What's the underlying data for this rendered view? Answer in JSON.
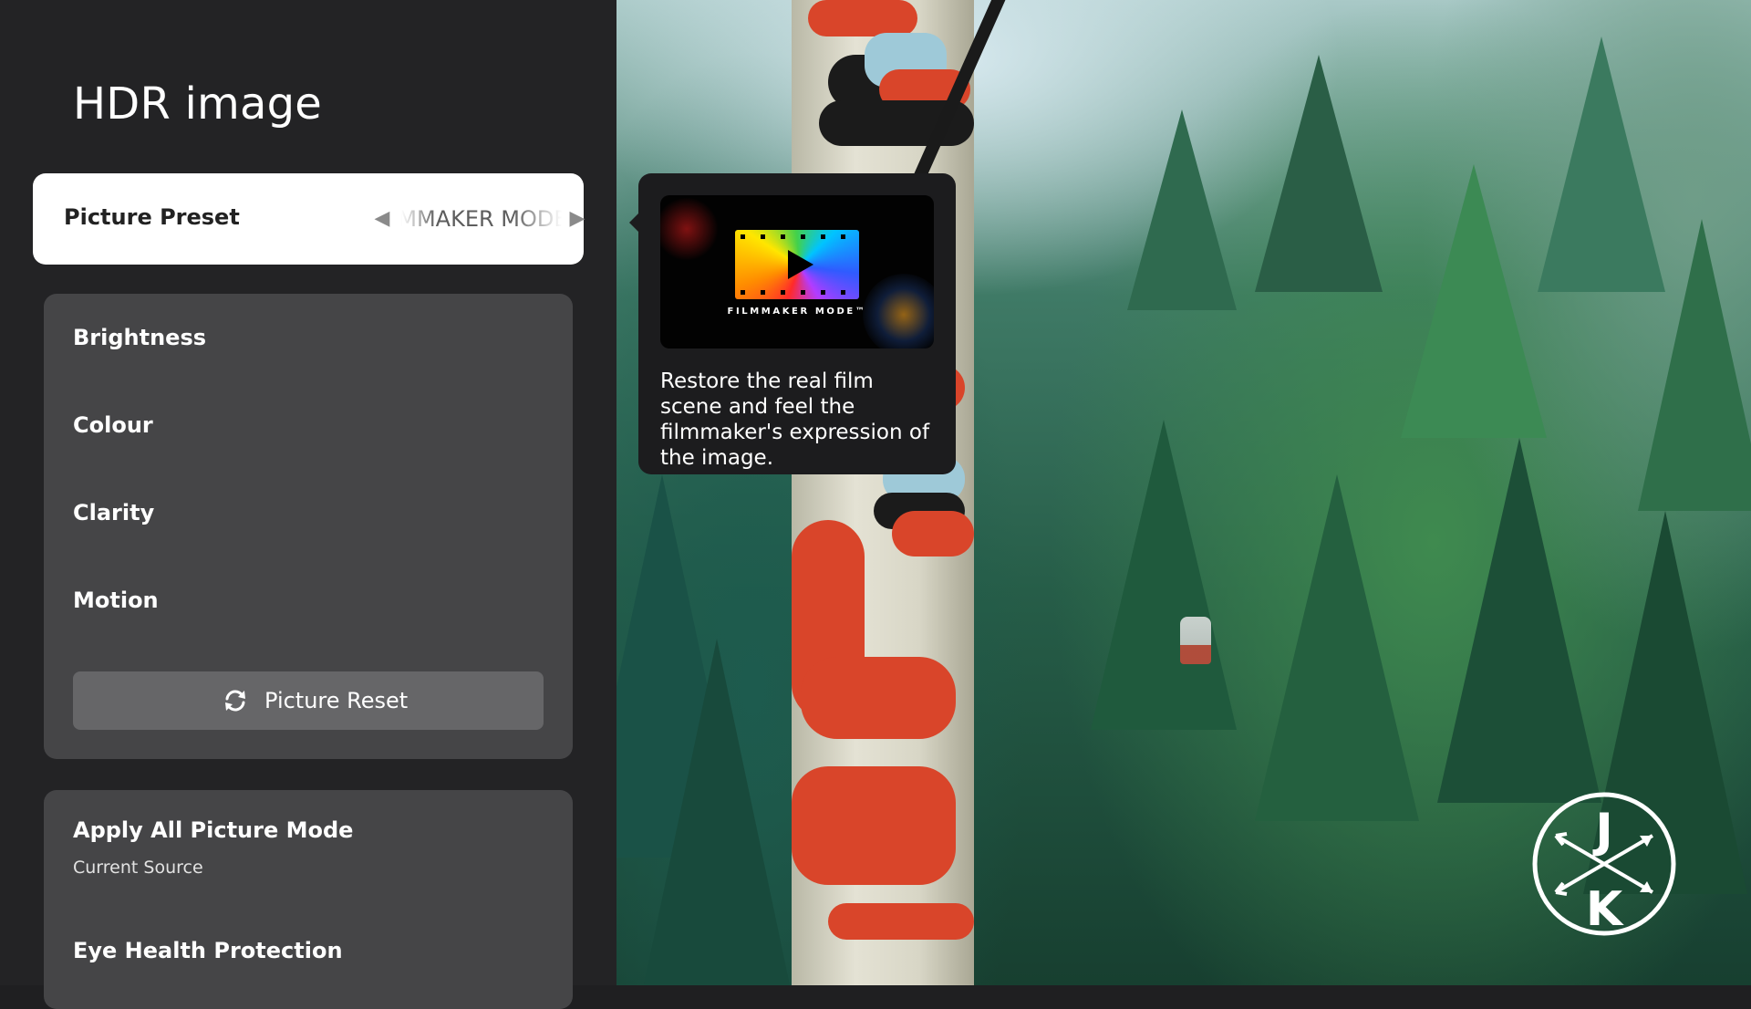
{
  "page": {
    "title": "HDR image"
  },
  "picture_preset": {
    "label": "Picture Preset",
    "value": "FILMMAKER MODE",
    "prev_icon": "chevron-left-icon",
    "next_icon": "chevron-right-icon"
  },
  "basic_settings": {
    "items": [
      {
        "label": "Brightness"
      },
      {
        "label": "Colour"
      },
      {
        "label": "Clarity"
      },
      {
        "label": "Motion"
      }
    ],
    "reset": {
      "label": "Picture Reset",
      "icon": "refresh-icon"
    }
  },
  "extra_settings": {
    "apply_all": {
      "label": "Apply All Picture Mode",
      "value": "Current Source"
    },
    "eye_health": {
      "label": "Eye Health Protection"
    }
  },
  "tooltip": {
    "logo_text": "FILMMAKER MODE™",
    "description": "Restore the real film scene and feel the filmmaker's expression of the image."
  },
  "watermark": {
    "letter_top": "J",
    "letter_bottom": "K"
  },
  "colors": {
    "panel_bg": "#232325",
    "group_bg": "#454547",
    "selected_row_bg": "#ffffff",
    "reset_button_bg": "#666668",
    "tooltip_bg": "#1c1c1e"
  }
}
